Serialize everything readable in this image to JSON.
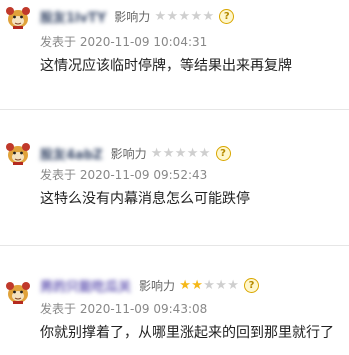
{
  "comments": [
    {
      "username": "股友1lvTY",
      "influence_label": "影响力",
      "influence_stars": 0,
      "help": "?",
      "time": "发表于 2020-11-09 10:04:31",
      "text": "这情况应该临时停牌，等结果出来再复牌"
    },
    {
      "username": "股友4abZ",
      "influence_label": "影响力",
      "influence_stars": 0,
      "help": "?",
      "time": "发表于 2020-11-09 09:52:43",
      "text": "这特么没有内幕消息怎么可能跌停"
    },
    {
      "username": "男的只能吃瓜关",
      "influence_label": "影响力",
      "influence_stars": 2,
      "help": "?",
      "time": "发表于 2020-11-09 09:43:08",
      "text": "你就别撑着了，从哪里涨起来的回到那里就行了"
    }
  ],
  "colors": {
    "star_on": "#f5b819",
    "star_off": "#cfcfcf",
    "username": "#3a4a6a",
    "username_alt": "#6e62b8"
  },
  "icons": {
    "avatar": "tiger-avatar-icon",
    "help": "help-question-icon",
    "star": "star-icon"
  }
}
